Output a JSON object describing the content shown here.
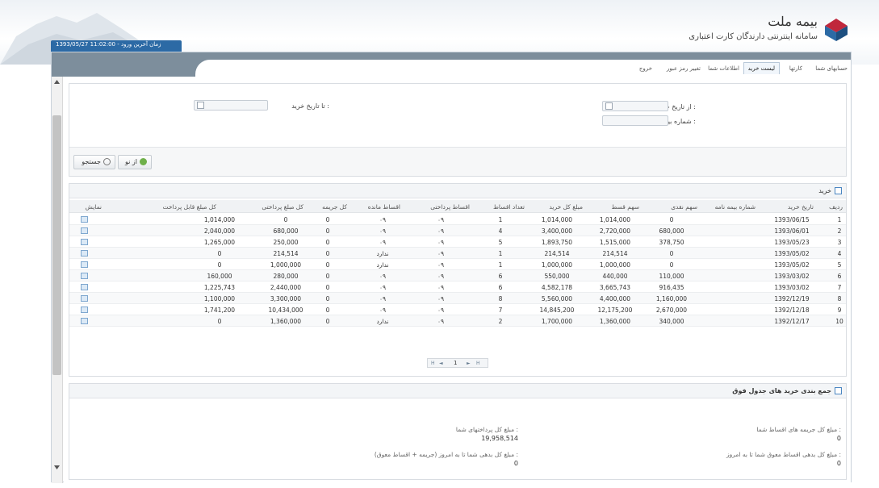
{
  "header": {
    "brand_name": "بیمه ملت",
    "brand_subtitle": "سامانه اینترنتی دارندگان کارت اعتباری",
    "last_login": "1393/05/27 11:02:00 - زمان آخرین ورود"
  },
  "nav_tabs": [
    "حسابهای شما",
    "کارتها",
    "لیست خرید",
    "اطلاعات شما",
    "تغییر رمز عبور",
    "خروج"
  ],
  "active_tab_index": 2,
  "search": {
    "from_date_label": ": از تاریخ خرید",
    "to_date_label": ": تا تاریخ خرید",
    "policy_number_label": ": شماره بیمه نامه",
    "from_date_value": "",
    "to_date_value": "",
    "policy_number_value": "",
    "search_button": "جستجو",
    "reset_button": "از نو"
  },
  "purchases": {
    "title": "خرید",
    "columns": [
      "ردیف",
      "تاریخ خرید",
      "شماره بیمه نامه",
      "سهم نقدی",
      "سهم قسط",
      "مبلغ کل خرید",
      "تعداد اقساط",
      "اقساط پرداختی",
      "اقساط مانده",
      "کل جریمه",
      "کل مبلغ پرداختی",
      "کل مبلغ قابل پرداخت",
      "نمایش"
    ],
    "rows": [
      {
        "row": "1",
        "date": "1393/06/15",
        "policy": "",
        "cash": "0",
        "installment": "1,014,000",
        "total": "1,014,000",
        "count": "1",
        "paid": "۰۹",
        "remaining": "۰۹",
        "penalty": "0",
        "total_paid": "0",
        "payable": "1,014,000"
      },
      {
        "row": "2",
        "date": "1393/06/01",
        "policy": "",
        "cash": "680,000",
        "installment": "2,720,000",
        "total": "3,400,000",
        "count": "4",
        "paid": "۰۹",
        "remaining": "۰۹",
        "penalty": "0",
        "total_paid": "680,000",
        "payable": "2,040,000"
      },
      {
        "row": "3",
        "date": "1393/05/23",
        "policy": "",
        "cash": "378,750",
        "installment": "1,515,000",
        "total": "1,893,750",
        "count": "5",
        "paid": "۰۹",
        "remaining": "۰۹",
        "penalty": "0",
        "total_paid": "250,000",
        "payable": "1,265,000"
      },
      {
        "row": "4",
        "date": "1393/05/02",
        "policy": "",
        "cash": "0",
        "installment": "214,514",
        "total": "214,514",
        "count": "1",
        "paid": "۰۹",
        "remaining": "ندارد",
        "penalty": "0",
        "total_paid": "214,514",
        "payable": "0"
      },
      {
        "row": "5",
        "date": "1393/05/02",
        "policy": "",
        "cash": "0",
        "installment": "1,000,000",
        "total": "1,000,000",
        "count": "1",
        "paid": "۰۹",
        "remaining": "ندارد",
        "penalty": "0",
        "total_paid": "1,000,000",
        "payable": "0"
      },
      {
        "row": "6",
        "date": "1393/03/02",
        "policy": "",
        "cash": "110,000",
        "installment": "440,000",
        "total": "550,000",
        "count": "6",
        "paid": "۰۹",
        "remaining": "۰۹",
        "penalty": "0",
        "total_paid": "280,000",
        "payable": "160,000"
      },
      {
        "row": "7",
        "date": "1393/03/02",
        "policy": "",
        "cash": "916,435",
        "installment": "3,665,743",
        "total": "4,582,178",
        "count": "6",
        "paid": "۰۹",
        "remaining": "۰۹",
        "penalty": "0",
        "total_paid": "2,440,000",
        "payable": "1,225,743"
      },
      {
        "row": "8",
        "date": "1392/12/19",
        "policy": "",
        "cash": "1,160,000",
        "installment": "4,400,000",
        "total": "5,560,000",
        "count": "8",
        "paid": "۰۹",
        "remaining": "۰۹",
        "penalty": "0",
        "total_paid": "3,300,000",
        "payable": "1,100,000"
      },
      {
        "row": "9",
        "date": "1392/12/18",
        "policy": "",
        "cash": "2,670,000",
        "installment": "12,175,200",
        "total": "14,845,200",
        "count": "7",
        "paid": "۰۹",
        "remaining": "۰۹",
        "penalty": "0",
        "total_paid": "10,434,000",
        "payable": "1,741,200"
      },
      {
        "row": "10",
        "date": "1392/12/17",
        "policy": "",
        "cash": "340,000",
        "installment": "1,360,000",
        "total": "1,700,000",
        "count": "2",
        "paid": "۰۹",
        "remaining": "ندارد",
        "penalty": "0",
        "total_paid": "1,360,000",
        "payable": "0"
      }
    ],
    "pager": {
      "first": "H",
      "prev": "◄",
      "page": "1",
      "next": "►",
      "last": "H"
    }
  },
  "summary": {
    "title": "جمع بندی خرید های جدول فوق",
    "penalty_label": ": مبلغ کل جریمه های اقساط شما",
    "penalty_value": "0",
    "paid_label": ": مبلغ کل پرداختهای شما",
    "paid_value": "19,958,514",
    "overdue_label": ": مبلغ کل بدهی اقساط معوق شما تا به امروز",
    "overdue_value": "0",
    "debt_label": ": مبلغ کل بدهی شما تا به امروز (جریمه + اقساط معوق)",
    "debt_value": "0"
  },
  "colors": {
    "accent": "#2c6aa5",
    "brand_red": "#c0273c",
    "band": "#7d8e9c"
  }
}
